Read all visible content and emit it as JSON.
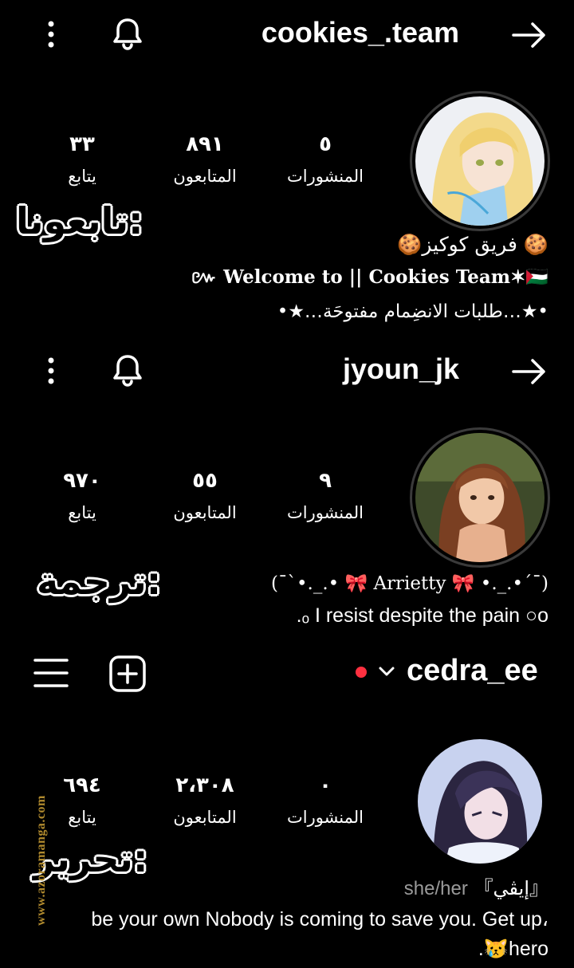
{
  "profiles": [
    {
      "username": "cookies_.team",
      "stats": {
        "posts_value": "٥",
        "posts_label": "المنشورات",
        "followers_value": "٨٩١",
        "followers_label": "المتابعون",
        "following_value": "٣٣",
        "following_label": "يتابع"
      },
      "bio_lines": [
        "🍪فريق كوكيز 🍪",
        "៚ Welcome to || Cookies Team✶🇵🇸",
        "•★…طلبات الانضِمام مفتوحَة…★•"
      ]
    },
    {
      "username": "jyoun_jk",
      "stats": {
        "posts_value": "٩",
        "posts_label": "المنشورات",
        "followers_value": "٥٥",
        "followers_label": "المتابعون",
        "following_value": "٩٧٠",
        "following_label": "يتابع"
      },
      "bio_lines": [
        "(¯`•._.•  🎀  Arrietty  🎀  •._.•´¯)",
        ".ₒ  I resist despite the pain ○o"
      ]
    },
    {
      "username": "cedra_ee",
      "stats": {
        "posts_value": "٠",
        "posts_label": "المنشورات",
        "followers_value": "٢،٣٠٨",
        "followers_label": "المتابعون",
        "following_value": "٦٩٤",
        "following_label": "يتابع"
      },
      "pronouns": "she/her",
      "name": "『إيڤي』",
      "bio_lines": [
        "be your own Nobody is coming to save you. Get up،",
        ".😿hero"
      ]
    }
  ],
  "overlays": {
    "follow_us": "تابعونا:",
    "translation": "ترجمة:",
    "editing": "تحرير:"
  },
  "watermark": "www.azoramanga.com",
  "colors": {
    "background": "#000000",
    "text": "#ffffff",
    "live_dot": "#ff3040",
    "watermark": "#b08a2e"
  }
}
